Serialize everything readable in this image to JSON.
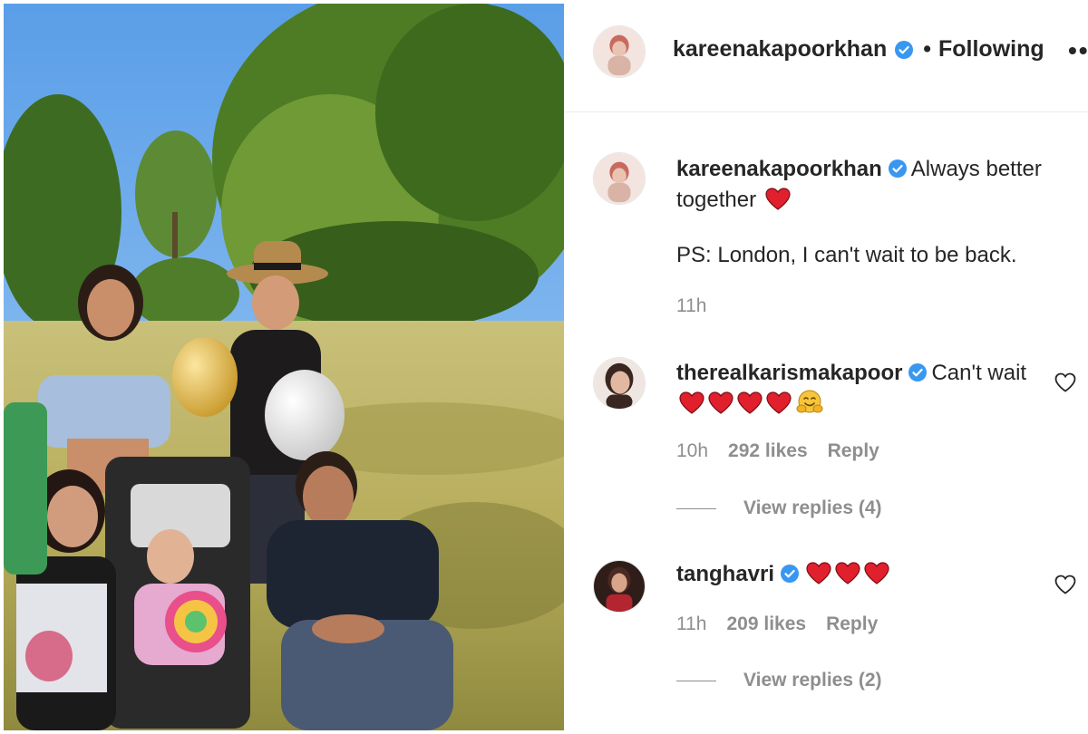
{
  "post": {
    "author": "kareenakapoorkhan",
    "follow_separator": "•",
    "follow_label": "Following",
    "more_icon": "more-options-icon"
  },
  "caption": {
    "username": "kareenakapoorkhan",
    "text": "Always better together",
    "line2": "PS: London, I can't wait to be back.",
    "time": "11h"
  },
  "comments": [
    {
      "username": "therealkarismakapoor",
      "text": "Can't wait",
      "emojis": [
        "heart",
        "heart",
        "heart",
        "heart",
        "hugging-face"
      ],
      "time": "10h",
      "likes": "292 likes",
      "reply_label": "Reply",
      "view_replies": "View replies (4)"
    },
    {
      "username": "tanghavri",
      "text": "",
      "emojis": [
        "heart",
        "heart",
        "heart"
      ],
      "time": "11h",
      "likes": "209 likes",
      "reply_label": "Reply",
      "view_replies": "View replies (2)"
    }
  ],
  "colors": {
    "verified": "#3897f0",
    "heart": "#e0202c",
    "muted": "#8e8e8e",
    "text": "#262626"
  }
}
